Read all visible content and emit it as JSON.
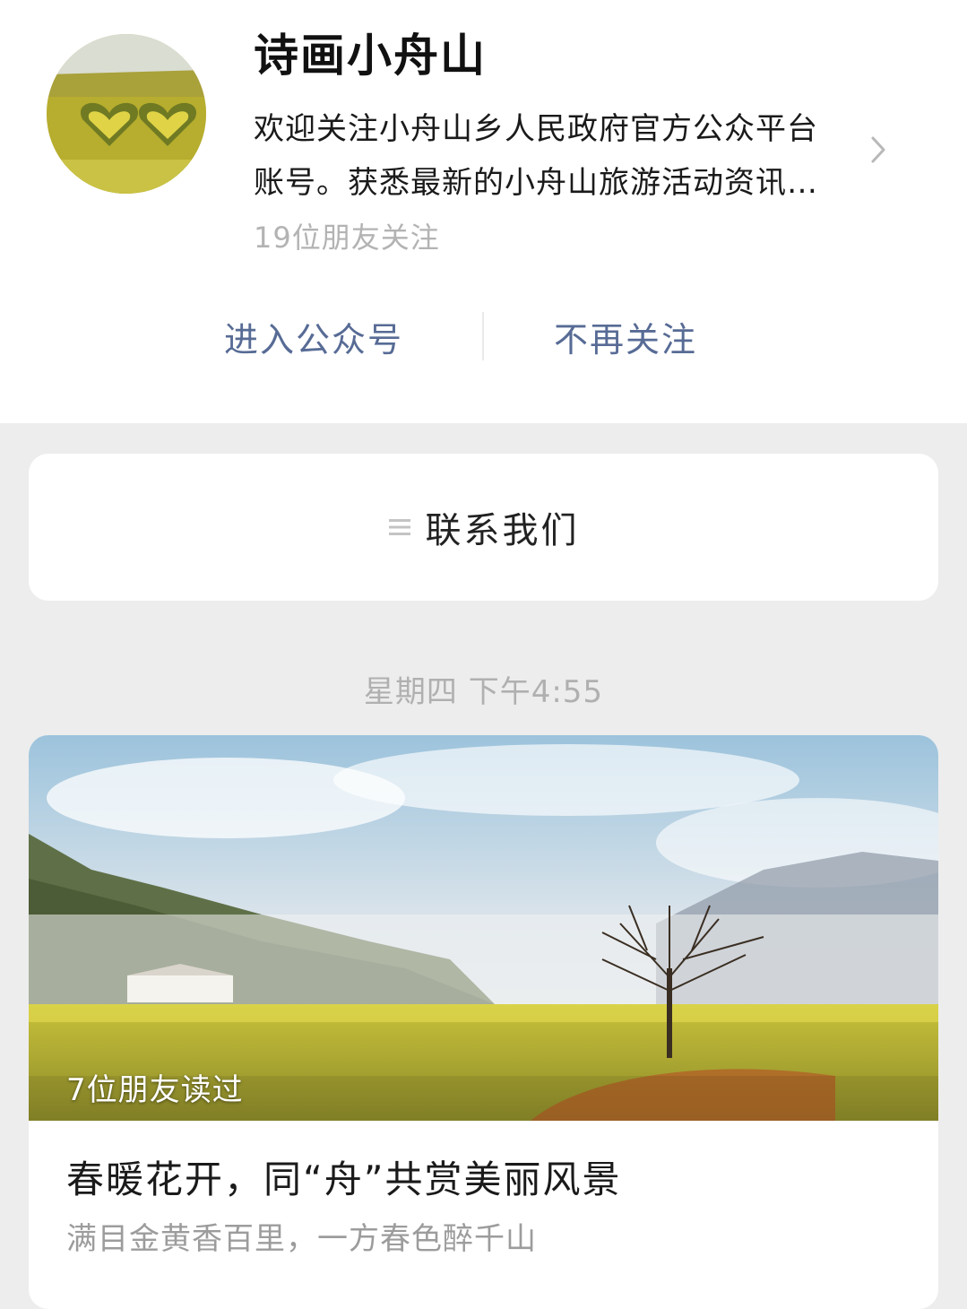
{
  "account": {
    "name": "诗画小舟山",
    "description_line1": "欢迎关注小舟山乡人民政府官方公众平台",
    "description_line2": "账号。获悉最新的小舟山旅游活动资讯…",
    "followers": "19位朋友关注"
  },
  "actions": {
    "enter_label": "进入公众号",
    "unfollow_label": "不再关注"
  },
  "menu": {
    "contact_label": "联系我们",
    "contact_icon": "menu-lines-icon"
  },
  "feed": {
    "timestamp": "星期四 下午4:55",
    "article": {
      "read_badge": "7位朋友读过",
      "title": "春暖花开，同“舟”共赏美丽风景",
      "subtitle": "满目金黄香百里，一方春色醉千山"
    }
  },
  "colors": {
    "link": "#576b95",
    "background": "#ededed",
    "muted": "#b0b0b0"
  }
}
